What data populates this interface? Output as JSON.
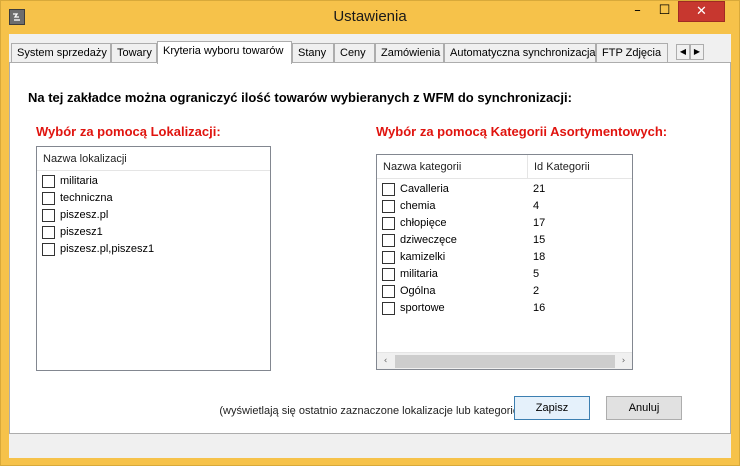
{
  "window": {
    "title": "Ustawienia",
    "minimize_glyph": "–",
    "maximize_glyph": "☐",
    "close_glyph": "✕"
  },
  "tabs": [
    {
      "label": "System sprzedaży",
      "active": false
    },
    {
      "label": "Towary",
      "active": false
    },
    {
      "label": "Kryteria wyboru towarów",
      "active": true
    },
    {
      "label": "Stany",
      "active": false
    },
    {
      "label": "Ceny",
      "active": false
    },
    {
      "label": "Zamówienia",
      "active": false
    },
    {
      "label": "Automatyczna synchronizacja",
      "active": false
    },
    {
      "label": "FTP Zdjęcia",
      "active": false
    }
  ],
  "tab_scroll": {
    "left_glyph": "◀",
    "right_glyph": "▶"
  },
  "page": {
    "heading": "Na tej zakładce można ograniczyć ilość towarów wybieranych z WFM do synchronizacji:",
    "footnote": "(wyświetlają się ostatnio zaznaczone lokalizacje lub kategorie)"
  },
  "locations": {
    "title": "Wybór za pomocą Lokalizacji:",
    "column_header": "Nazwa lokalizacji",
    "items": [
      {
        "name": "militaria",
        "checked": false
      },
      {
        "name": "techniczna",
        "checked": false
      },
      {
        "name": "piszesz.pl",
        "checked": false
      },
      {
        "name": "piszesz1",
        "checked": false
      },
      {
        "name": "piszesz.pl,piszesz1",
        "checked": false
      }
    ]
  },
  "categories": {
    "title": "Wybór za pomocą Kategorii Asortymentowych:",
    "column_name_header": "Nazwa kategorii",
    "column_id_header": "Id Kategorii",
    "items": [
      {
        "name": "Cavalleria",
        "id": "21",
        "checked": false
      },
      {
        "name": "chemia",
        "id": "4",
        "checked": false
      },
      {
        "name": "chłopięce",
        "id": "17",
        "checked": false
      },
      {
        "name": "dziweczęce",
        "id": "15",
        "checked": false
      },
      {
        "name": "kamizelki",
        "id": "18",
        "checked": false
      },
      {
        "name": "militaria",
        "id": "5",
        "checked": false
      },
      {
        "name": "Ogólna",
        "id": "2",
        "checked": false
      },
      {
        "name": "sportowe",
        "id": "16",
        "checked": false
      }
    ],
    "scroll_left_glyph": "‹",
    "scroll_right_glyph": "›"
  },
  "buttons": {
    "save_label": "Zapisz",
    "cancel_label": "Anuluj"
  },
  "colors": {
    "frame": "#f6c24a",
    "section_title": "#e0140f",
    "close_button": "#c7372f"
  }
}
